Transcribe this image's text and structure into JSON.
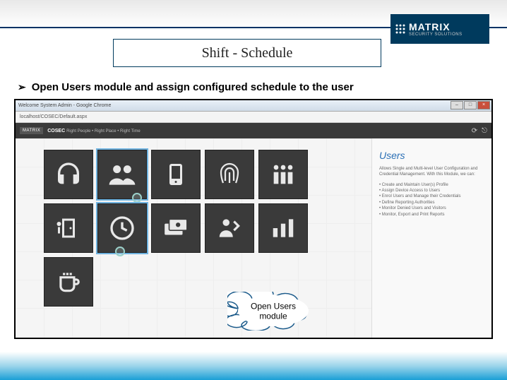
{
  "logo": {
    "main": "MATRIX",
    "sub": "SECURITY SOLUTIONS"
  },
  "title": "Shift - Schedule",
  "bullet": "Open Users module and assign configured schedule to the user",
  "browser": {
    "title": "Welcome System Admin - Google Chrome",
    "url": "localhost/COSEC/Default.aspx"
  },
  "app": {
    "brand": "MATRIX",
    "product": "COSEC",
    "tagline": "Right People • Right Place • Right Time"
  },
  "side": {
    "title": "Users",
    "desc": "Allows Single and Multi-level User Configuration and Credential Management. With this Module, we can:",
    "items": [
      "Create and Maintain User(s) Profile",
      "Assign Device Access to Users",
      "Enrol Users and Manage their Credentials",
      "Define Reporting Authorities",
      "Monitor Denied Users and Visitors",
      "Monitor, Export and Print Reports"
    ]
  },
  "callout": {
    "line1": "Open Users",
    "line2": "module"
  },
  "tiles": [
    {
      "name": "admin-tile",
      "icon": "headset"
    },
    {
      "name": "users-tile",
      "icon": "people",
      "highlight": true
    },
    {
      "name": "device-tile",
      "icon": "phone"
    },
    {
      "name": "biometric-tile",
      "icon": "fingerprint"
    },
    {
      "name": "org-tile",
      "icon": "group"
    },
    {
      "name": "access-tile",
      "icon": "door"
    },
    {
      "name": "time-tile",
      "icon": "clock",
      "highlight": true
    },
    {
      "name": "payroll-tile",
      "icon": "money"
    },
    {
      "name": "visitor-tile",
      "icon": "visitor"
    },
    {
      "name": "report-tile",
      "icon": "chart"
    },
    {
      "name": "cafe-tile",
      "icon": "cup"
    }
  ]
}
